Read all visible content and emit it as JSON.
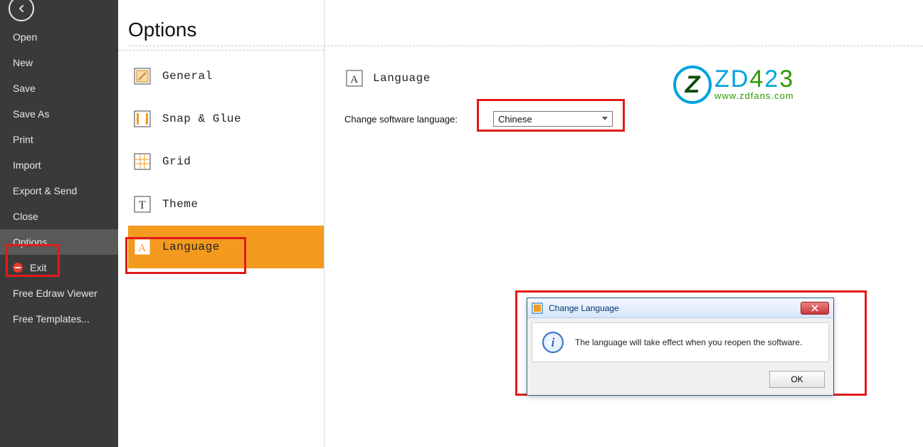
{
  "sidebar": {
    "items": [
      {
        "label": "Open"
      },
      {
        "label": "New"
      },
      {
        "label": "Save"
      },
      {
        "label": "Save As"
      },
      {
        "label": "Print"
      },
      {
        "label": "Import"
      },
      {
        "label": "Export & Send"
      },
      {
        "label": "Close"
      },
      {
        "label": "Options"
      },
      {
        "label": "Exit"
      },
      {
        "label": "Free Edraw Viewer"
      },
      {
        "label": "Free Templates..."
      }
    ]
  },
  "panel": {
    "title": "Options",
    "items": [
      {
        "label": "General"
      },
      {
        "label": "Snap & Glue"
      },
      {
        "label": "Grid"
      },
      {
        "label": "Theme"
      },
      {
        "label": "Language"
      }
    ]
  },
  "content": {
    "section_label": "Language",
    "field_label": "Change software language:",
    "selected_language": "Chinese"
  },
  "watermark": {
    "brand": "ZD423",
    "url": "www.zdfans.com"
  },
  "dialog": {
    "title": "Change Language",
    "message": "The language will take effect when you reopen the software.",
    "ok": "OK"
  }
}
